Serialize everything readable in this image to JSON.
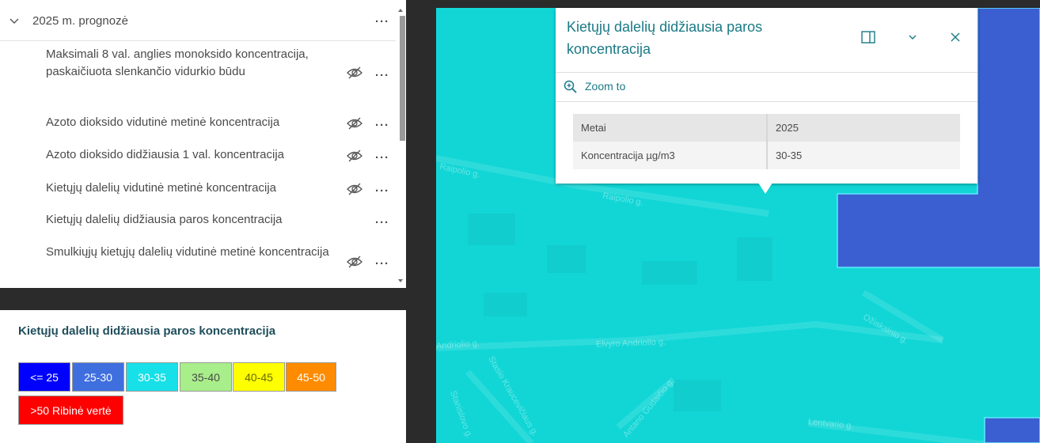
{
  "layer_list": {
    "group_title": "2025 m. prognozė",
    "more_label": "···",
    "items": [
      {
        "label": "Maksimali 8 val. anglies monoksido koncentracija, paskaičiuota slenkančio vidurkio būdu",
        "hidden": true
      },
      {
        "label": "Azoto dioksido vidutinė metinė koncentracija",
        "hidden": true
      },
      {
        "label": "Azoto dioksido didžiausia 1 val. koncentracija",
        "hidden": true
      },
      {
        "label": "Kietųjų dalelių vidutinė metinė koncentracija",
        "hidden": true
      },
      {
        "label": "Kietųjų dalelių didžiausia paros koncentracija",
        "hidden": false
      },
      {
        "label": "Smulkiųjų kietųjų dalelių vidutinė metinė koncentracija",
        "hidden": true
      }
    ]
  },
  "legend": {
    "title": "Kietųjų dalelių didžiausia paros koncentracija",
    "classes": [
      {
        "label": "<= 25",
        "color": "#0000ff",
        "text_color": "#ffffff"
      },
      {
        "label": "25-30",
        "color": "#3f6fdf",
        "text_color": "#ffffff"
      },
      {
        "label": "30-35",
        "color": "#18e0e8",
        "text_color": "#ffffff"
      },
      {
        "label": "35-40",
        "color": "#a8ee8a",
        "text_color": "#4a4a4a"
      },
      {
        "label": "40-45",
        "color": "#ffff00",
        "text_color": "#6a6a00"
      },
      {
        "label": "45-50",
        "color": "#ff8c00",
        "text_color": "#ffffff"
      },
      {
        "label": ">50 Ribinė vertė",
        "color": "#ff0000",
        "text_color": "#ffffff"
      }
    ]
  },
  "popup": {
    "title": "Kietųjų dalelių didžiausia paros koncentracija",
    "zoom_label": "Zoom to",
    "attributes": [
      {
        "key": "Metai",
        "value": "2025"
      },
      {
        "key": "Koncentracija µg/m3",
        "value": "30-35"
      }
    ]
  },
  "map": {
    "streets": [
      "Raipolio g.",
      "Raipolio g.",
      "Elvyro Andriolio g.",
      "Andriolio g.",
      "Stasio Kraucevičiaus g.",
      "Antano Gudaičio g.",
      "Ožiakalnio g.",
      "Lentvario g.",
      "Stanislovo g."
    ],
    "colors": {
      "class_30_35": "#12d6d6",
      "class_25_30": "#3b5fd0"
    }
  }
}
